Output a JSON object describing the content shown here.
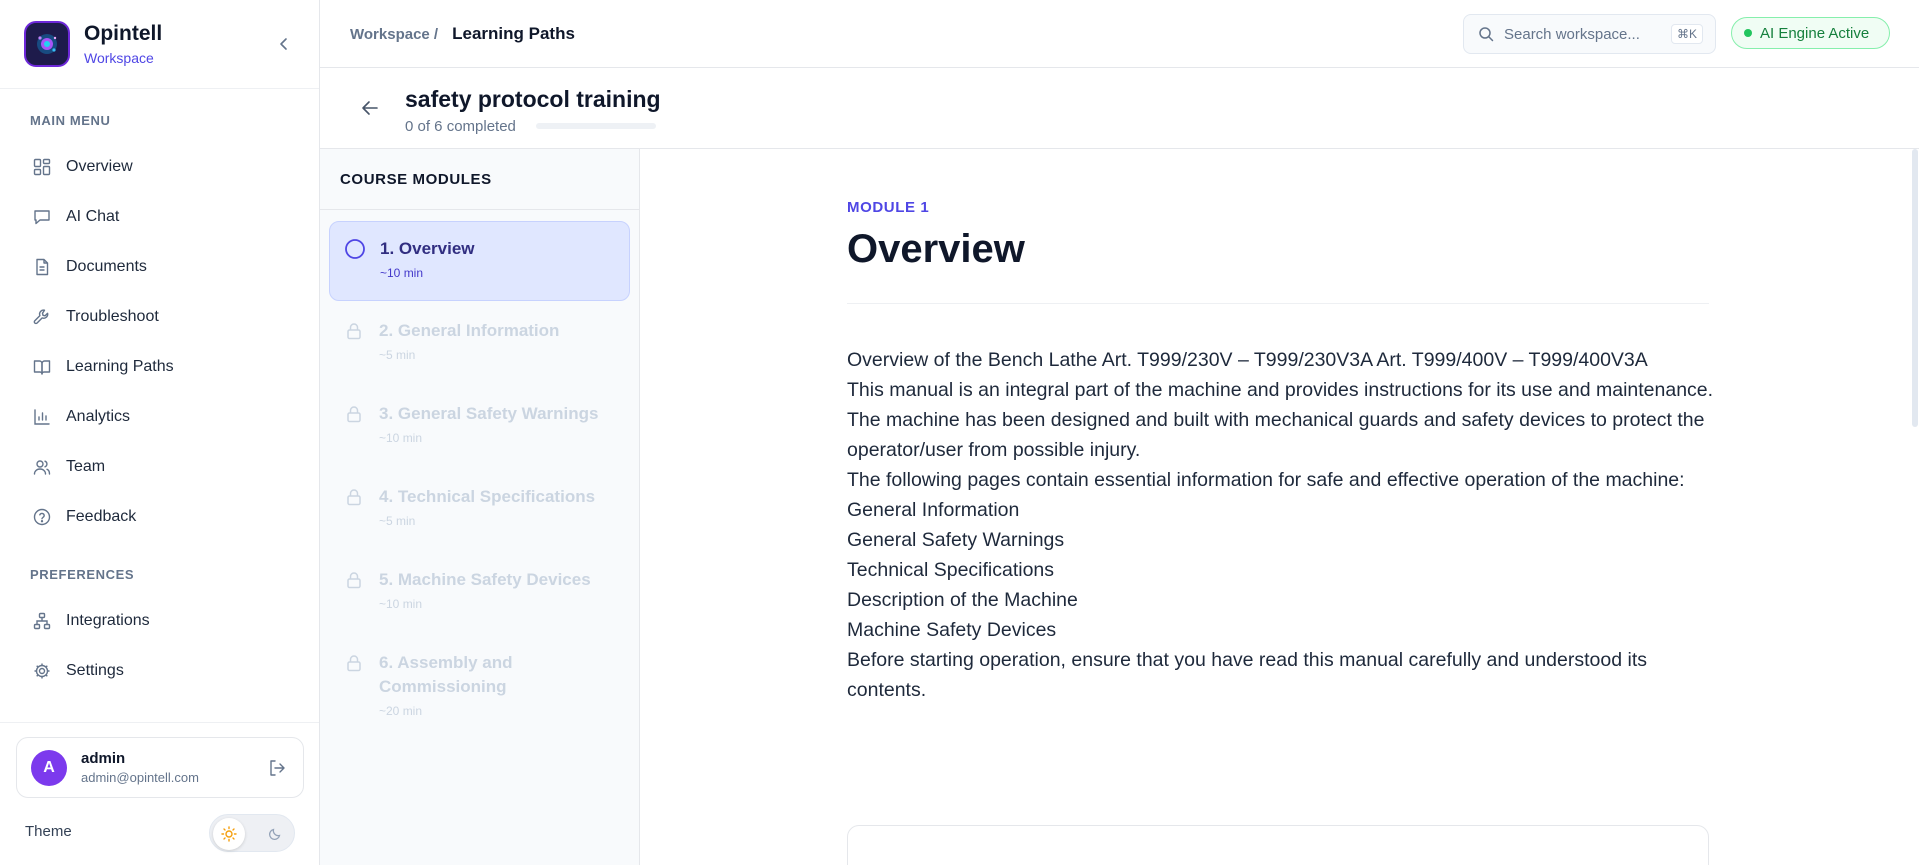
{
  "brand": {
    "name": "Opintell",
    "subtitle": "Workspace"
  },
  "sidebar": {
    "main_menu_title": "MAIN MENU",
    "main_items": [
      {
        "label": "Overview",
        "icon": "grid-icon"
      },
      {
        "label": "AI Chat",
        "icon": "chat-icon"
      },
      {
        "label": "Documents",
        "icon": "document-icon"
      },
      {
        "label": "Troubleshoot",
        "icon": "wrench-icon"
      },
      {
        "label": "Learning Paths",
        "icon": "book-icon"
      },
      {
        "label": "Analytics",
        "icon": "bar-chart-icon"
      },
      {
        "label": "Team",
        "icon": "users-icon"
      },
      {
        "label": "Feedback",
        "icon": "help-circle-icon"
      }
    ],
    "preferences_title": "PREFERENCES",
    "pref_items": [
      {
        "label": "Integrations",
        "icon": "network-icon"
      },
      {
        "label": "Settings",
        "icon": "gear-icon"
      }
    ],
    "user": {
      "initial": "A",
      "name": "admin",
      "email": "admin@opintell.com"
    },
    "theme_label": "Theme"
  },
  "topbar": {
    "breadcrumb_parent": "Workspace /",
    "breadcrumb_current": "Learning Paths",
    "search_placeholder": "Search workspace...",
    "search_shortcut": "⌘K",
    "ai_status": "AI Engine Active"
  },
  "course": {
    "title": "safety protocol training",
    "progress_text": "0 of 6 completed",
    "progress_fraction": 0
  },
  "modules_panel": {
    "title": "COURSE MODULES",
    "modules": [
      {
        "title": "1. Overview",
        "time": "~10 min",
        "state": "active"
      },
      {
        "title": "2. General Information",
        "time": "~5 min",
        "state": "locked"
      },
      {
        "title": "3. General Safety Warnings",
        "time": "~10 min",
        "state": "locked"
      },
      {
        "title": "4. Technical Specifications",
        "time": "~5 min",
        "state": "locked"
      },
      {
        "title": "5. Machine Safety Devices",
        "time": "~10 min",
        "state": "locked"
      },
      {
        "title": "6. Assembly and Commissioning",
        "time": "~20 min",
        "state": "locked"
      }
    ]
  },
  "content": {
    "module_tag": "MODULE 1",
    "heading": "Overview",
    "paragraphs": [
      "Overview of the Bench Lathe Art. T999/230V – T999/230V3A Art. T999/400V – T999/400V3A",
      "This manual is an integral part of the machine and provides instructions for its use and maintenance. The machine has been designed and built with mechanical guards and safety devices to protect the operator/user from possible injury.",
      "The following pages contain essential information for safe and effective operation of the machine:",
      "General Information",
      "General Safety Warnings",
      "Technical Specifications",
      "Description of the Machine",
      "Machine Safety Devices",
      "Before starting operation, ensure that you have read this manual carefully and understood its contents."
    ]
  },
  "colors": {
    "accent": "#4f46e5",
    "active_module_bg": "#e0e7ff",
    "status_green": "#22c55e",
    "avatar": "#7c3aed"
  }
}
